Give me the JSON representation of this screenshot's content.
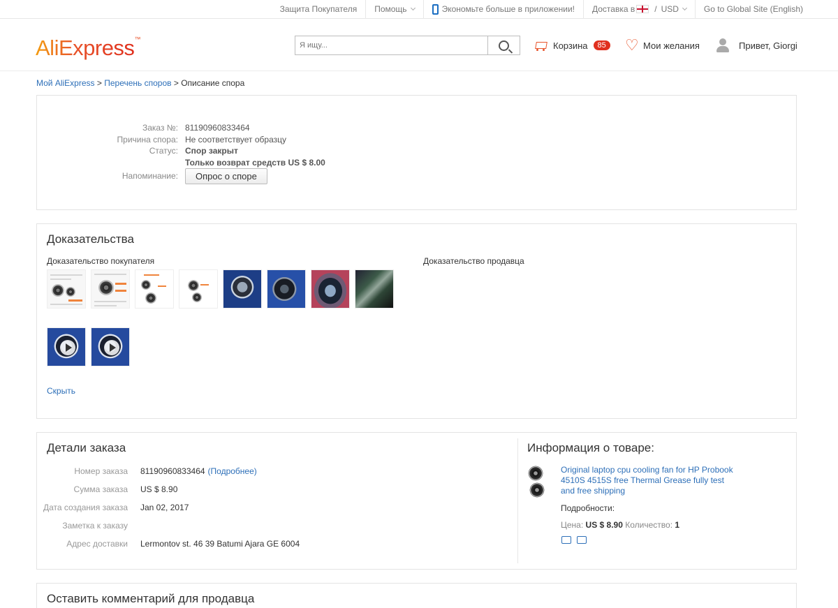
{
  "topbar": {
    "buyer_protection": "Защита Покупателя",
    "help": "Помощь",
    "app_promo": "Экономьте больше в приложении!",
    "delivery_prefix": "Доставка в",
    "currency_sep": "/",
    "currency": "USD",
    "global_site": "Go to Global Site (English)"
  },
  "header": {
    "logo_text": "AliExpress",
    "logo_tm": "™",
    "search_placeholder": "Я ищу...",
    "cart_label": "Корзина",
    "cart_count": "85",
    "wishlist_label": "Мои желания",
    "greeting": "Привет, Giorgi"
  },
  "breadcrumb": {
    "items": [
      "Мой AliExpress",
      "Перечень споров"
    ],
    "separator": " > ",
    "current": "Описание спора"
  },
  "dispute": {
    "order_label": "Заказ №:",
    "order_value": "81190960833464",
    "reason_label": "Причина спора:",
    "reason_value": "Не соответствует образцу",
    "status_label": "Статус:",
    "status_value": "Спор закрыт",
    "refund_value": "Только возврат средств US $ 8.00",
    "reminder_label": "Напоминание:",
    "survey_button": "Опрос о споре"
  },
  "evidence": {
    "title": "Доказательства",
    "buyer_label": "Доказательство покупателя",
    "seller_label": "Доказательство продавца",
    "hide_link": "Скрыть"
  },
  "order_details": {
    "title": "Детали заказа",
    "rows": [
      {
        "label": "Номер заказа",
        "value": "81190960833464",
        "link": "(Подробнее)"
      },
      {
        "label": "Сумма заказа",
        "value": "US $ 8.90"
      },
      {
        "label": "Дата создания заказа",
        "value": "Jan 02, 2017"
      },
      {
        "label": "Заметка к заказу",
        "value": ""
      },
      {
        "label": "Адрес доставки",
        "value": "Lermontov st. 46 39 Batumi Ajara GE 6004"
      }
    ]
  },
  "product_info": {
    "title": "Информация о товаре:",
    "product_title": "Original laptop cpu cooling fan for HP Probook 4510S 4515S free Thermal Grease fully test and free shipping",
    "details_label": "Подробности:",
    "price_label": "Цена:",
    "price_value": "US $ 8.90",
    "qty_label": "Количество:",
    "qty_value": "1"
  },
  "comment": {
    "title": "Оставить комментарий для продавца"
  },
  "colors": {
    "accent": "#e8532a",
    "link": "#2d6fb8",
    "success": "#1a9b18",
    "badge": "#e0301e"
  }
}
